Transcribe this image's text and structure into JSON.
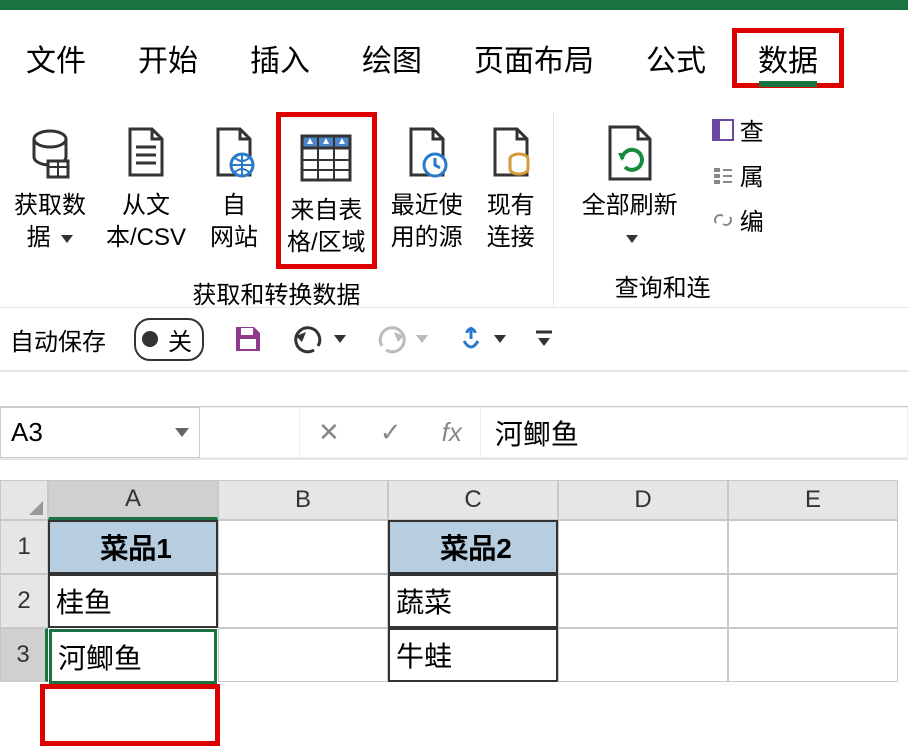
{
  "tabs": {
    "file": "文件",
    "home": "开始",
    "insert": "插入",
    "draw": "绘图",
    "layout": "页面布局",
    "formula": "公式",
    "data": "数据"
  },
  "ribbon": {
    "group1_label": "获取和转换数据",
    "group2_label": "查询和连",
    "get_data": "获取数\n据 ",
    "from_csv": "从文\n本/CSV",
    "from_web": "自\n网站",
    "from_table": "来自表\n格/区域",
    "recent": "最近使\n用的源",
    "existing": "现有\n连接",
    "refresh": "全部刷新",
    "side1": "查",
    "side2": "属",
    "side3": "编"
  },
  "qat": {
    "autosave_label": "自动保存",
    "autosave_state": "关"
  },
  "formula_bar": {
    "name_box": "A3",
    "value": "河鲫鱼"
  },
  "columns": [
    "A",
    "B",
    "C",
    "D",
    "E"
  ],
  "rows": [
    "1",
    "2",
    "3"
  ],
  "table_data": {
    "A1": "菜品1",
    "A2": "桂鱼",
    "A3": "河鲫鱼",
    "C1": "菜品2",
    "C2": "蔬菜",
    "C3": "牛蛙"
  }
}
